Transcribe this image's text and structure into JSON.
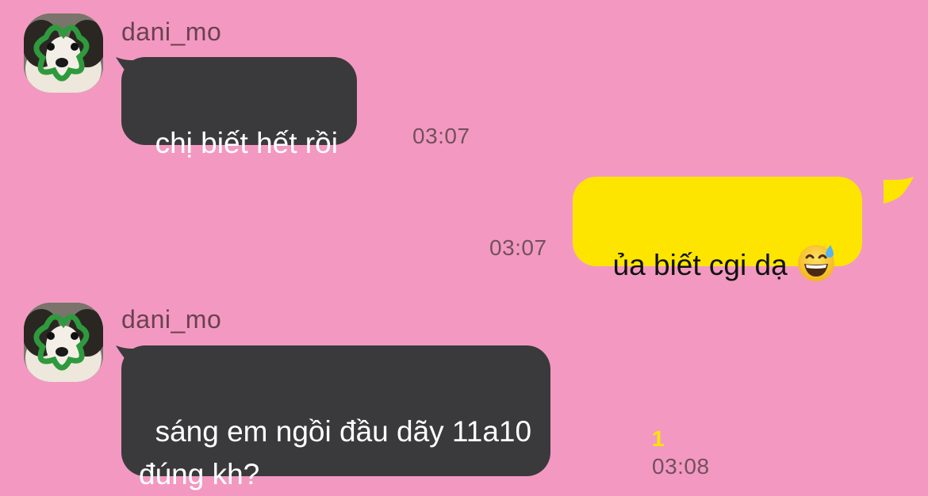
{
  "messages": [
    {
      "sender": "dani_mo",
      "avatar_icon": "dog-avatar-icon",
      "text": "chị biết hết rồi",
      "time": "03:07"
    },
    {
      "sender": "me",
      "text": "ủa biết cgi dạ",
      "emoji": "grinning-sweat-emoji",
      "time": "03:07"
    },
    {
      "sender": "dani_mo",
      "avatar_icon": "dog-avatar-icon",
      "text": "sáng em ngồi đầu dãy 11a10\nđúng kh?",
      "time": "03:08",
      "unread_count": "1"
    }
  ],
  "colors": {
    "background": "#f399c1",
    "incoming_bubble": "#3a3a3c",
    "outgoing_bubble": "#fee500",
    "unread": "#fee500"
  }
}
